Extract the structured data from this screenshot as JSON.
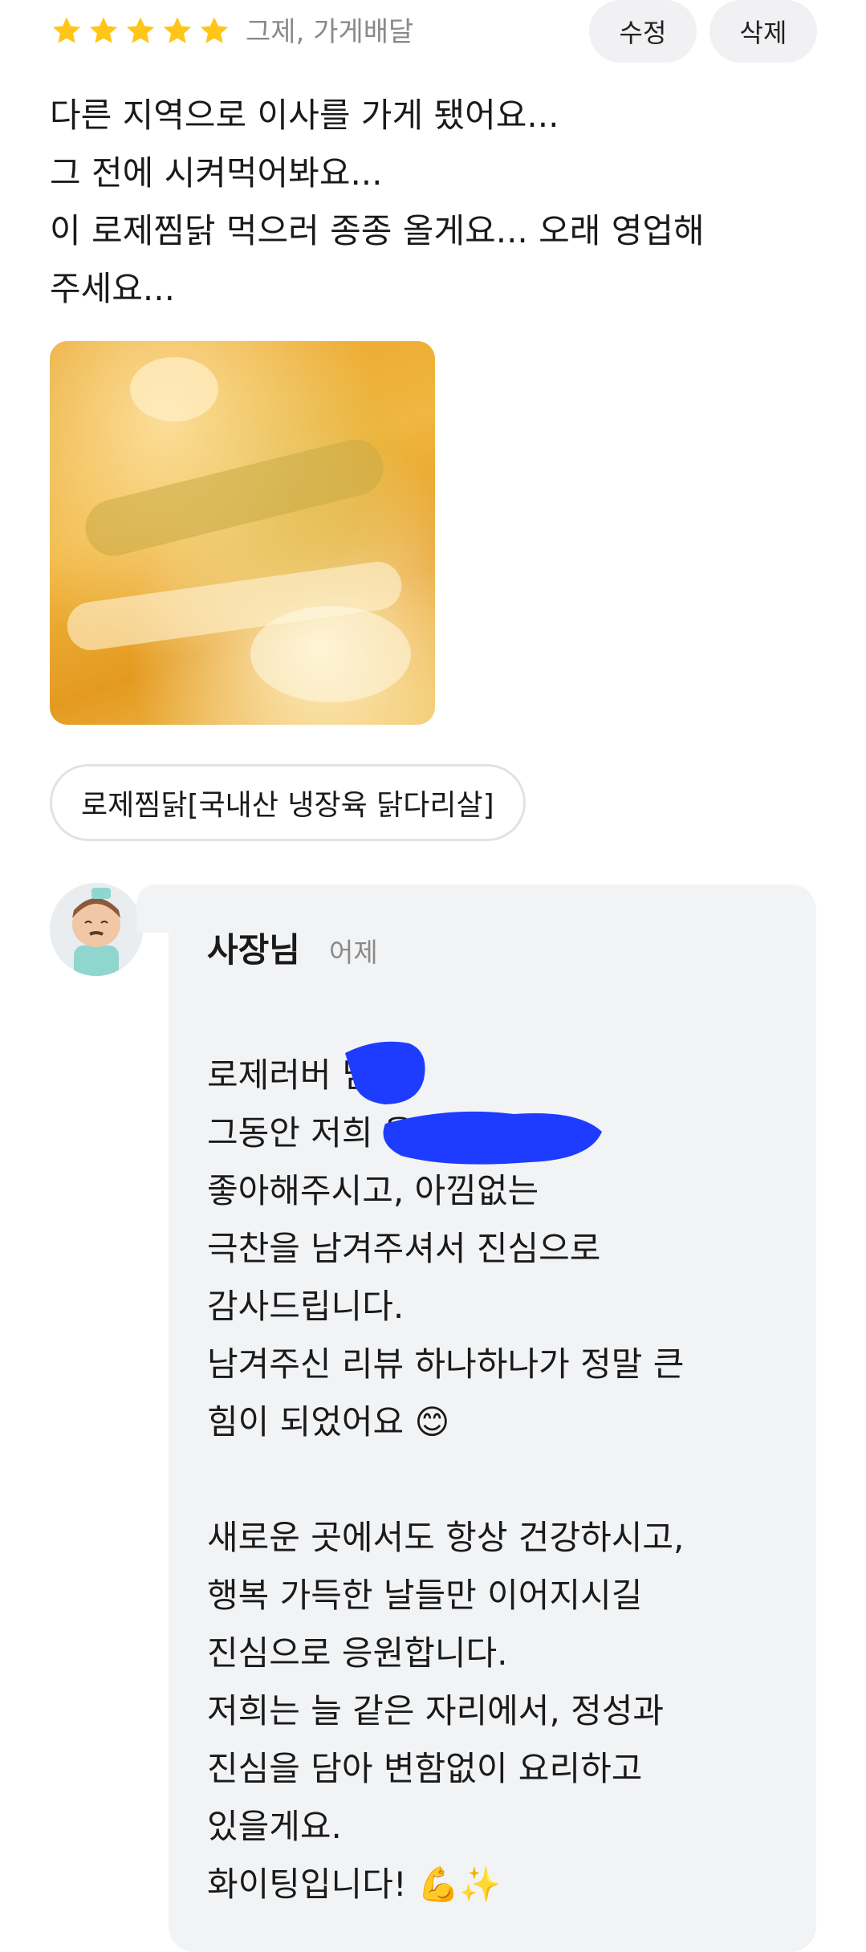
{
  "review": {
    "rating": 5,
    "meta": "그제, 가게배달",
    "edit_label": "수정",
    "delete_label": "삭제",
    "lines": [
      "다른 지역으로 이사를 가게 됐어요...",
      "그 전에 시켜먹어봐요...",
      "이 로제찜닭 먹으러 종종 올게요... 오래 영업해",
      "주세요..."
    ],
    "menu_tag": "로제찜닭[국내산 냉장육 닭다리살]"
  },
  "reply": {
    "author": "사장님",
    "date": "어제",
    "lines": [
      "로제러버 님❤️",
      "그동안 저희 을",
      "좋아해주시고, 아낌없는",
      "극찬을 남겨주셔서 진심으로",
      "감사드립니다.",
      "남겨주신 리뷰 하나하나가 정말 큰",
      "힘이 되었어요 😊",
      "",
      "새로운 곳에서도 항상 건강하시고,",
      "행복 가득한 날들만 이어지시길",
      "진심으로 응원합니다.",
      "저희는 늘 같은 자리에서, 정성과",
      "진심을 담아 변함없이 요리하고",
      "있을게요.",
      "화이팅입니다! 💪✨"
    ]
  },
  "colors": {
    "star": "#ffc517",
    "bubble": "#f2f3f5",
    "redaction": "#1e3cff"
  }
}
